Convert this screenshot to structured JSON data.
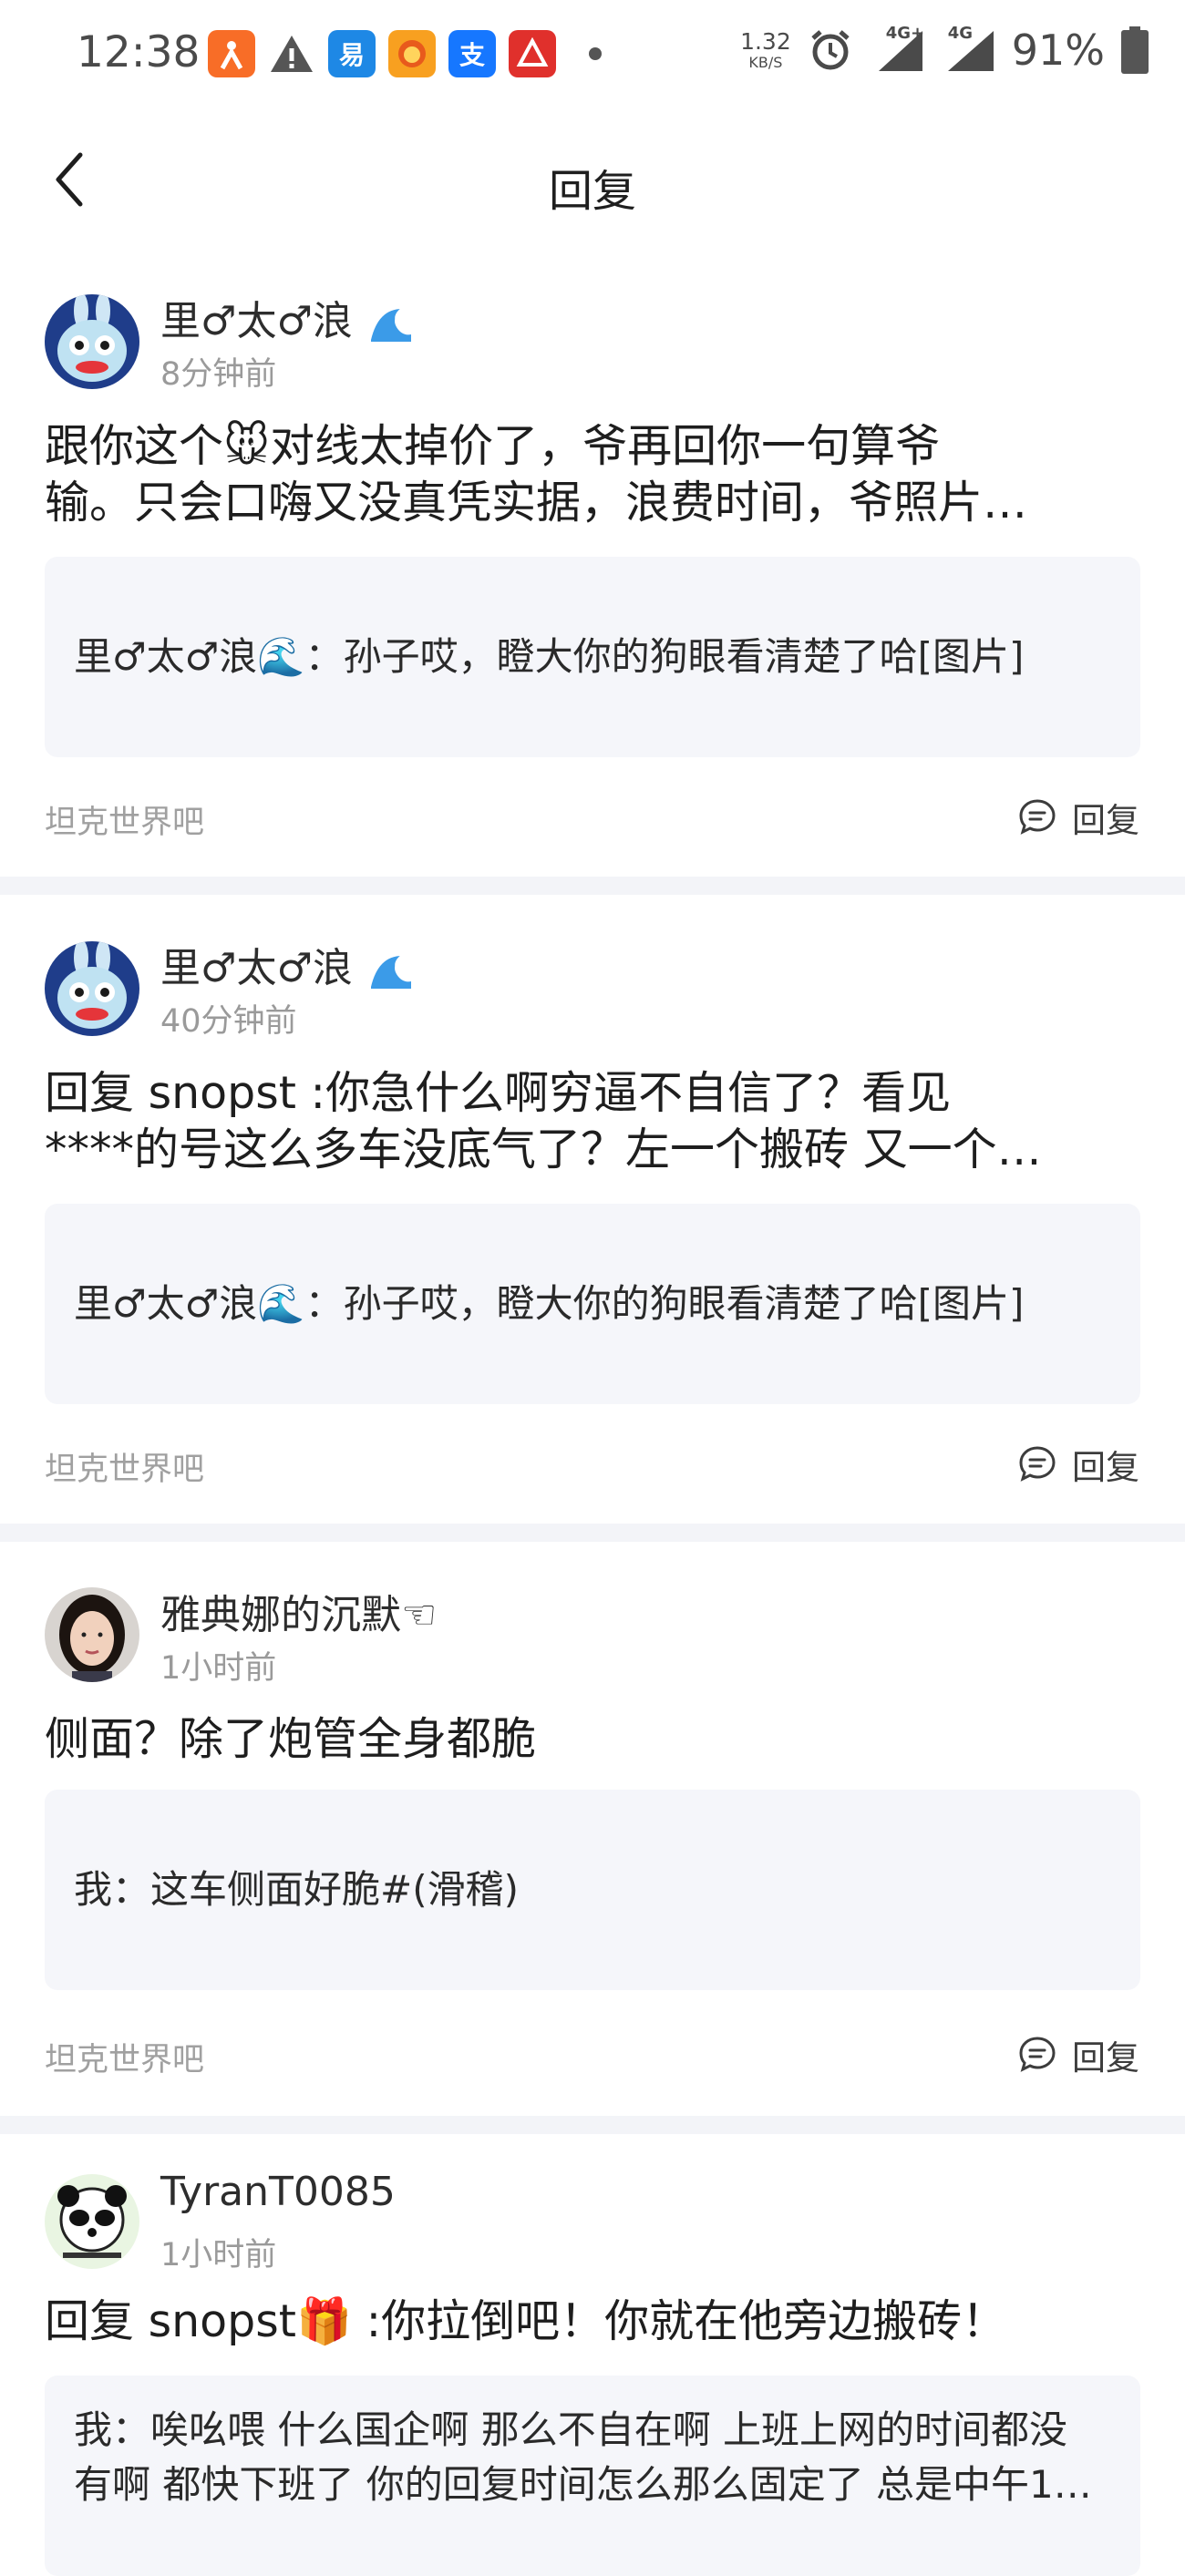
{
  "status_bar": {
    "time": "12:38",
    "net_speed_value": "1.32",
    "net_speed_unit": "KB/S",
    "signal1": "4G+",
    "signal2": "4G",
    "battery": "91%",
    "app_icons": [
      {
        "name": "app-icon-1",
        "label": "",
        "color": "#f86d27"
      },
      {
        "name": "app-icon-yi",
        "label": "易",
        "color": "#1e88e5"
      },
      {
        "name": "app-icon-lion",
        "label": "",
        "color": "#f8a020"
      },
      {
        "name": "app-icon-alipay",
        "label": "支",
        "color": "#1677ff"
      },
      {
        "name": "app-icon-red",
        "label": "",
        "color": "#e0302c"
      }
    ]
  },
  "header": {
    "title": "回复"
  },
  "posts": [
    {
      "user": "里♂太♂浪",
      "time": "8分钟前",
      "content_line1": "跟你这个🐭对线太掉价了，爷再回你一句算爷",
      "content_line2": "输。只会口嗨又没真凭实据，浪费时间，爷照片…",
      "quote_line1": "里♂太♂浪🌊：孙子哎，瞪大你的狗眼看清楚了哈[图片]",
      "quote_line2": "",
      "forum": "坦克世界吧",
      "reply_label": "回复"
    },
    {
      "user": "里♂太♂浪",
      "time": "40分钟前",
      "content_line1": "回复 snopst  :你急什么啊穷逼不自信了？看见",
      "content_line2": "****的号这么多车没底气了？左一个搬砖 又一个…",
      "quote_line1": "里♂太♂浪🌊：孙子哎，瞪大你的狗眼看清楚了哈[图片]",
      "quote_line2": "",
      "forum": "坦克世界吧",
      "reply_label": "回复"
    },
    {
      "user": "雅典娜的沉默☜",
      "time": "1小时前",
      "content_line1": "侧面？除了炮管全身都脆",
      "content_line2": "",
      "quote_line1": "我：这车侧面好脆#(滑稽)",
      "quote_line2": "",
      "forum": "坦克世界吧",
      "reply_label": "回复"
    },
    {
      "user": "TyranT0085",
      "time": "1小时前",
      "content_line1": "回复  snopst🎁 :你拉倒吧！你就在他旁边搬砖！",
      "content_line2": "",
      "quote_line1": "我：唉吆喂 什么国企啊 那么不自在啊 上班上网的时间都没",
      "quote_line2": "有啊 都快下班了 你的回复时间怎么那么固定了 总是中午1…",
      "forum": "",
      "reply_label": ""
    }
  ]
}
